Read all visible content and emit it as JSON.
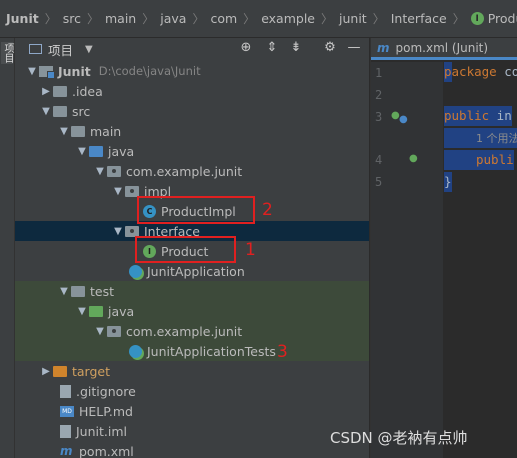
{
  "breadcrumb": {
    "items": [
      "Junit",
      "src",
      "main",
      "java",
      "com",
      "example",
      "junit",
      "Interface",
      "Product"
    ],
    "last_icon": "I"
  },
  "side_strip": {
    "label": "项目"
  },
  "project_panel": {
    "title": "项目",
    "tools": {
      "locate": "⊕",
      "expand": "⇕",
      "collapse": "⇟",
      "settings": "⚙",
      "hide": "—"
    }
  },
  "tree": [
    {
      "label": "Junit",
      "hint": "D:\\code\\java\\Junit"
    },
    {
      "label": ".idea"
    },
    {
      "label": "src"
    },
    {
      "label": "main"
    },
    {
      "label": "java"
    },
    {
      "label": "com.example.junit"
    },
    {
      "label": "impl"
    },
    {
      "label": "ProductImpl",
      "icon_letter": "C"
    },
    {
      "label": "Interface"
    },
    {
      "label": "Product",
      "icon_letter": "I"
    },
    {
      "label": "JunitApplication"
    },
    {
      "label": "test"
    },
    {
      "label": "java"
    },
    {
      "label": "com.example.junit"
    },
    {
      "label": "JunitApplicationTests"
    },
    {
      "label": "target"
    },
    {
      "label": ".gitignore"
    },
    {
      "label": "HELP.md",
      "icon_text": "MD"
    },
    {
      "label": "Junit.iml"
    },
    {
      "label": "pom.xml"
    }
  ],
  "annotations": {
    "one": "1",
    "two": "2",
    "three": "3"
  },
  "editor": {
    "tab_label": "pom.xml (Junit)",
    "line_numbers": [
      "1",
      "2",
      "3",
      "4",
      "5"
    ],
    "code": {
      "line1_kw": "package",
      "line1_rest": " co",
      "line3_kw": "public",
      "line3_rest": " in",
      "usage_hint": "1 个用法",
      "line4_kw": "publi",
      "line5": "}"
    }
  },
  "watermark": "CSDN @老衲有点帅",
  "colors": {
    "accent": "#4a88c7",
    "selection": "#0d293e",
    "annotation": "#e02020",
    "interface_icon": "#62a85b"
  }
}
